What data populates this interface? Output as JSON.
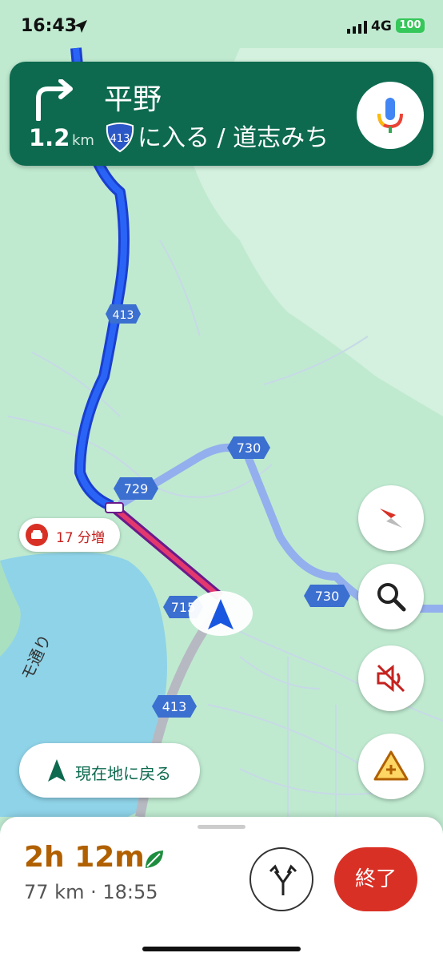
{
  "status_bar": {
    "time": "16:43",
    "network": "4G",
    "battery": "100"
  },
  "nav_card": {
    "distance_value": "1.2",
    "distance_unit": "km",
    "street": "平野",
    "route_number": "413",
    "instruction": "に入る / 道志みち",
    "colors": {
      "background": "#0d6a4f"
    }
  },
  "map": {
    "route_shields": [
      "413",
      "729",
      "730",
      "730",
      "715",
      "413"
    ],
    "road_label": "モ通り"
  },
  "traffic_chip": {
    "label": "17 分増",
    "color": "#d93025"
  },
  "recenter_button": {
    "label": "現在地に戻る"
  },
  "side_buttons": [
    "compass-icon",
    "search-icon",
    "mute-icon",
    "report-incident-icon"
  ],
  "bottom_sheet": {
    "duration": "2h 12m",
    "details": "77 km · 18:55",
    "end_label": "終了",
    "colors": {
      "duration": "#b06000",
      "end": "#d93025"
    }
  }
}
